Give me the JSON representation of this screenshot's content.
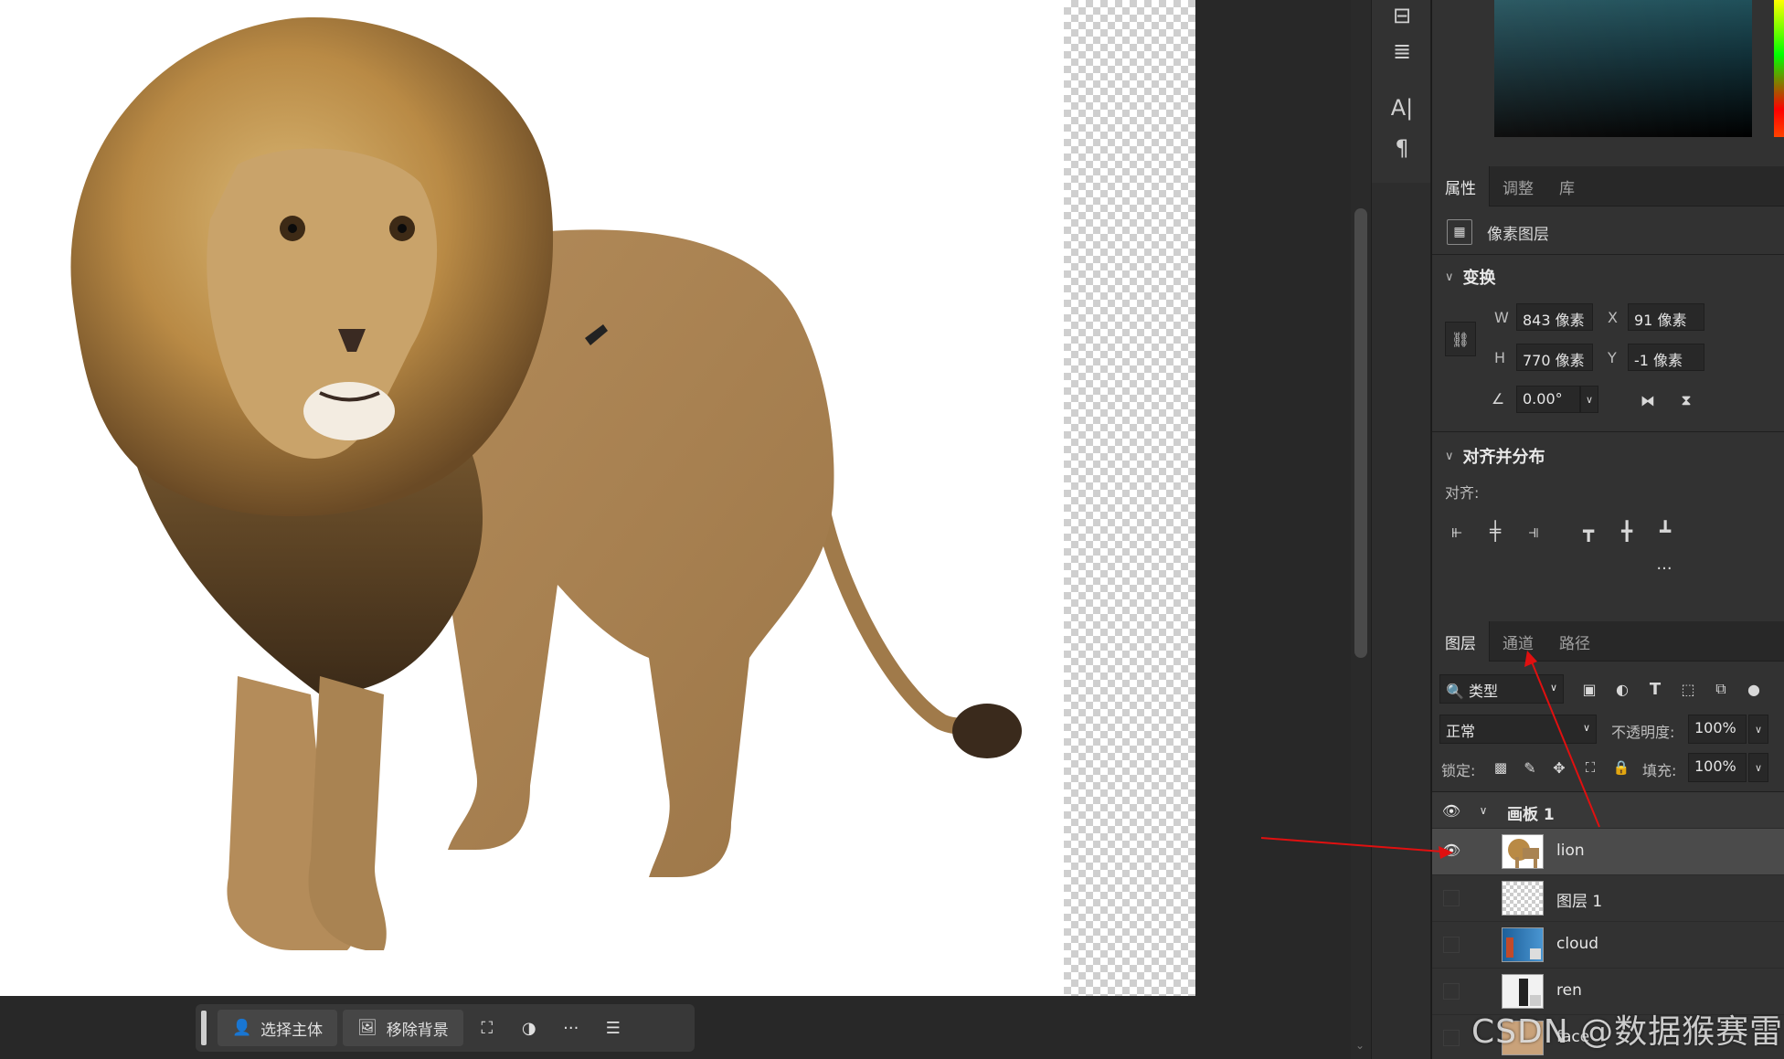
{
  "taskbar": {
    "select_subject": "选择主体",
    "remove_background": "移除背景",
    "more": "···"
  },
  "tools": {
    "type_tool": "A|",
    "paragraph_tool": "¶"
  },
  "properties_panel": {
    "tabs": [
      "属性",
      "调整",
      "库"
    ],
    "layer_kind": "像素图层",
    "transform": {
      "title": "变换",
      "w_label": "W",
      "w_value": "843 像素",
      "h_label": "H",
      "h_value": "770 像素",
      "x_label": "X",
      "x_value": "91 像素",
      "y_label": "Y",
      "y_value": "-1 像素",
      "angle_value": "0.00°"
    },
    "align": {
      "title": "对齐并分布",
      "label": "对齐:",
      "more": "···"
    }
  },
  "layers_panel": {
    "tabs": [
      "图层",
      "通道",
      "路径"
    ],
    "filter_kind": "类型",
    "blend_mode": "正常",
    "opacity_label": "不透明度:",
    "opacity_value": "100%",
    "lock_label": "锁定:",
    "fill_label": "填充:",
    "fill_value": "100%",
    "artboard_name": "画板 1",
    "layers": [
      {
        "name": "lion",
        "visible": true,
        "selected": true
      },
      {
        "name": "图层 1",
        "visible": false,
        "selected": false
      },
      {
        "name": "cloud",
        "visible": false,
        "selected": false
      },
      {
        "name": "ren",
        "visible": false,
        "selected": false
      },
      {
        "name": "face",
        "visible": false,
        "selected": false
      }
    ]
  },
  "watermark": "CSDN @数据猴赛雷",
  "colors": {
    "accent_arrow": "#e01010",
    "panel_bg": "#323232",
    "selected_layer": "#4b4b4b"
  }
}
